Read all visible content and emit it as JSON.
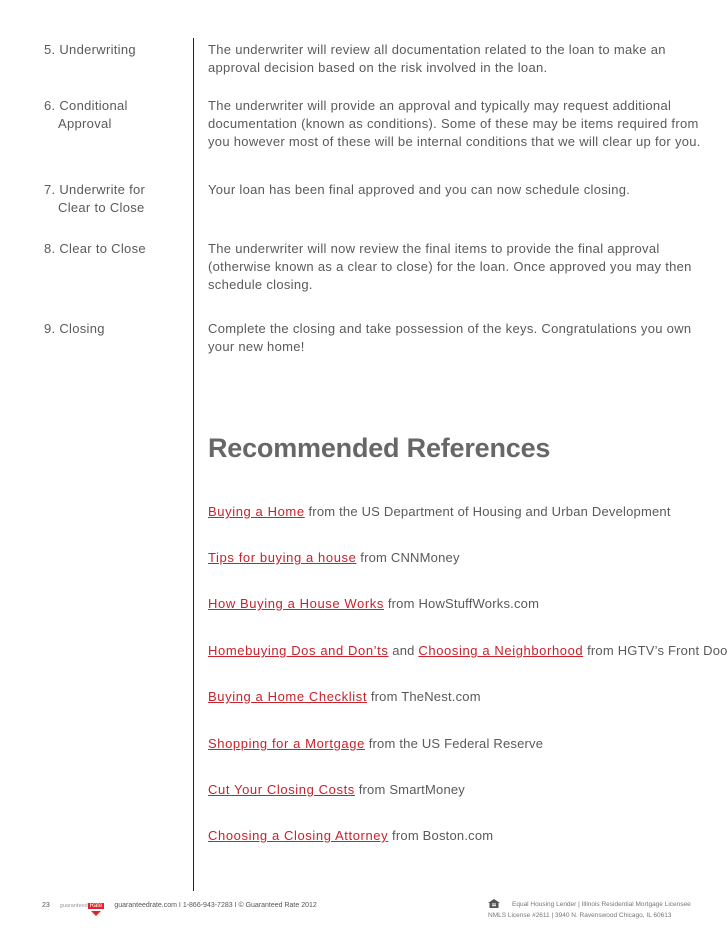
{
  "steps": [
    {
      "name_line1": "5. Underwriting",
      "name_line2": "",
      "description": "The underwriter will review all documentation related to the loan to make an approval decision based on the risk involved in the loan."
    },
    {
      "name_line1": "6. Conditional",
      "name_line2": "Approval",
      "description": "The underwriter will provide an approval and typically may request additional documentation (known as conditions). Some of these may be items required from you however most of these will be internal conditions that we will clear up for you."
    },
    {
      "name_line1": "7. Underwrite for",
      "name_line2": "Clear to Close",
      "description": "Your loan has been final approved and you can now schedule closing."
    },
    {
      "name_line1": "8. Clear to Close",
      "name_line2": "",
      "description": "The underwriter will now review the final items to provide the final approval (otherwise known as a clear to close) for the loan. Once approved you may then schedule closing."
    },
    {
      "name_line1": "9. Closing",
      "name_line2": "",
      "description": "Complete the closing and take possession of the keys. Congratulations you own your new home!"
    }
  ],
  "references": {
    "title": "Recommended References",
    "items": [
      {
        "link": "Buying a Home",
        "text": " from the US Department of Housing and Urban Development"
      },
      {
        "link": "Tips for buying a house",
        "text": " from CNNMoney"
      },
      {
        "link": "How Buying a House Works",
        "text": " from HowStuffWorks.com"
      },
      {
        "link": "Homebuying Dos and Don’ts",
        "text": " and ",
        "link2": "Choosing a Neighborhood",
        "text2": " from HGTV’s Front Door"
      },
      {
        "link": "Buying a Home Checklist",
        "text": " from TheNest.com"
      },
      {
        "link": "Shopping for a Mortgage",
        "text": " from the US Federal Reserve"
      },
      {
        "link": "Cut Your Closing Costs",
        "text": " from SmartMoney"
      },
      {
        "link": "Choosing a Closing Attorney",
        "text": " from Boston.com"
      }
    ]
  },
  "footer": {
    "page_number": "23",
    "logo_small": "guaranteed",
    "logo_rate": "Rate",
    "contact": "guaranteedrate.com I 1-866-943-7283 I © Guaranteed Rate 2012",
    "legal_line1": "Equal Housing Lender | Illinois Residential Mortgage Licensee",
    "legal_line2": "NMLS License #2611 | 3940 N. Ravenswood Chicago, IL 60613"
  },
  "colors": {
    "link": "#c8222c",
    "brand": "#e3232b"
  }
}
